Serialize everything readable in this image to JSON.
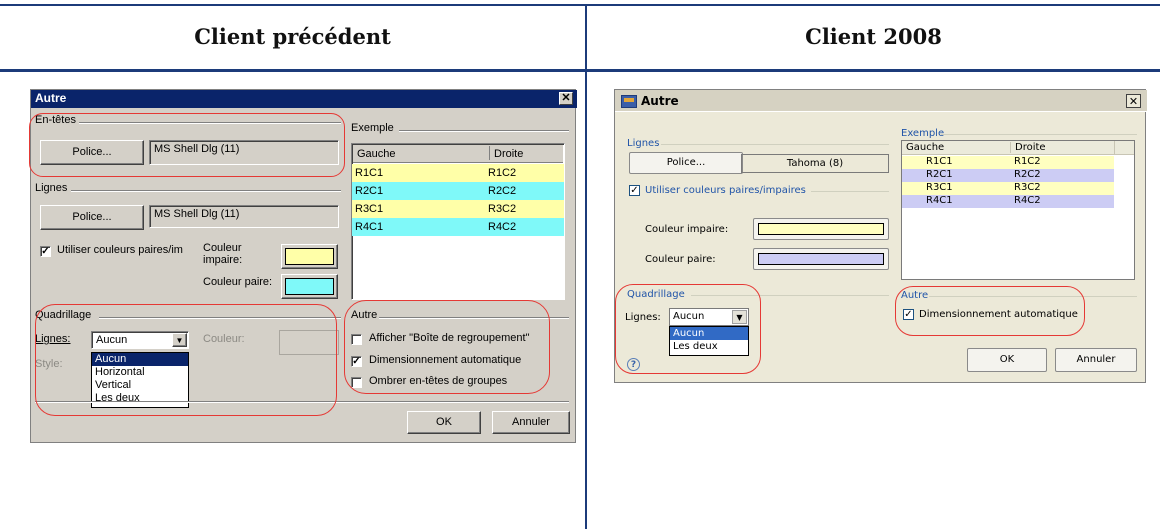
{
  "headers": {
    "left": "Client précédent",
    "right": "Client 2008"
  },
  "old": {
    "title": "Autre",
    "close": "✕",
    "headers_group": "En-têtes",
    "police_btn": "Police...",
    "font_value": "MS Shell Dlg (11)",
    "lines_group": "Lignes",
    "police_btn2": "Police...",
    "font_value2": "MS Shell Dlg (11)",
    "use_colors": "Utiliser couleurs paires/im",
    "couleur_impaire": "Couleur impaire:",
    "couleur_paire": "Couleur paire:",
    "grid_group": "Quadrillage",
    "lignes_label": "Lignes:",
    "lignes_value": "Aucun",
    "couleur_label": "Couleur:",
    "style_label": "Style:",
    "dropdown": [
      "Aucun",
      "Horizontal",
      "Vertical",
      "Les deux"
    ],
    "example_group": "Exemple",
    "col_left": "Gauche",
    "col_right": "Droite",
    "rows": [
      {
        "l": "R1C1",
        "r": "R1C2"
      },
      {
        "l": "R2C1",
        "r": "R2C2"
      },
      {
        "l": "R3C1",
        "r": "R3C2"
      },
      {
        "l": "R4C1",
        "r": "R4C2"
      }
    ],
    "autre_group": "Autre",
    "opt1": "Afficher \"Boîte de regroupement\"",
    "opt2": "Dimensionnement automatique",
    "opt3": "Ombrer en-têtes de groupes",
    "ok": "OK",
    "cancel": "Annuler",
    "colors": {
      "odd": "#ffffa8",
      "even": "#7ff9f9"
    }
  },
  "new": {
    "title": "Autre",
    "close": "✕",
    "lines_group": "Lignes",
    "police_btn": "Police...",
    "font_value": "Tahoma (8)",
    "use_colors": "Utiliser couleurs paires/impaires",
    "couleur_impaire": "Couleur impaire:",
    "couleur_paire": "Couleur paire:",
    "grid_group": "Quadrillage",
    "lignes_label": "Lignes:",
    "lignes_value": "Aucun",
    "dropdown": [
      "Aucun",
      "Les deux"
    ],
    "help": "?",
    "example_group": "Exemple",
    "col_left": "Gauche",
    "col_right": "Droite",
    "rows": [
      {
        "l": "R1C1",
        "r": "R1C2"
      },
      {
        "l": "R2C1",
        "r": "R2C2"
      },
      {
        "l": "R3C1",
        "r": "R3C2"
      },
      {
        "l": "R4C1",
        "r": "R4C2"
      }
    ],
    "autre_group": "Autre",
    "opt1": "Dimensionnement automatique",
    "ok": "OK",
    "cancel": "Annuler",
    "colors": {
      "odd": "#ffffc0",
      "even": "#ccccf4"
    }
  }
}
